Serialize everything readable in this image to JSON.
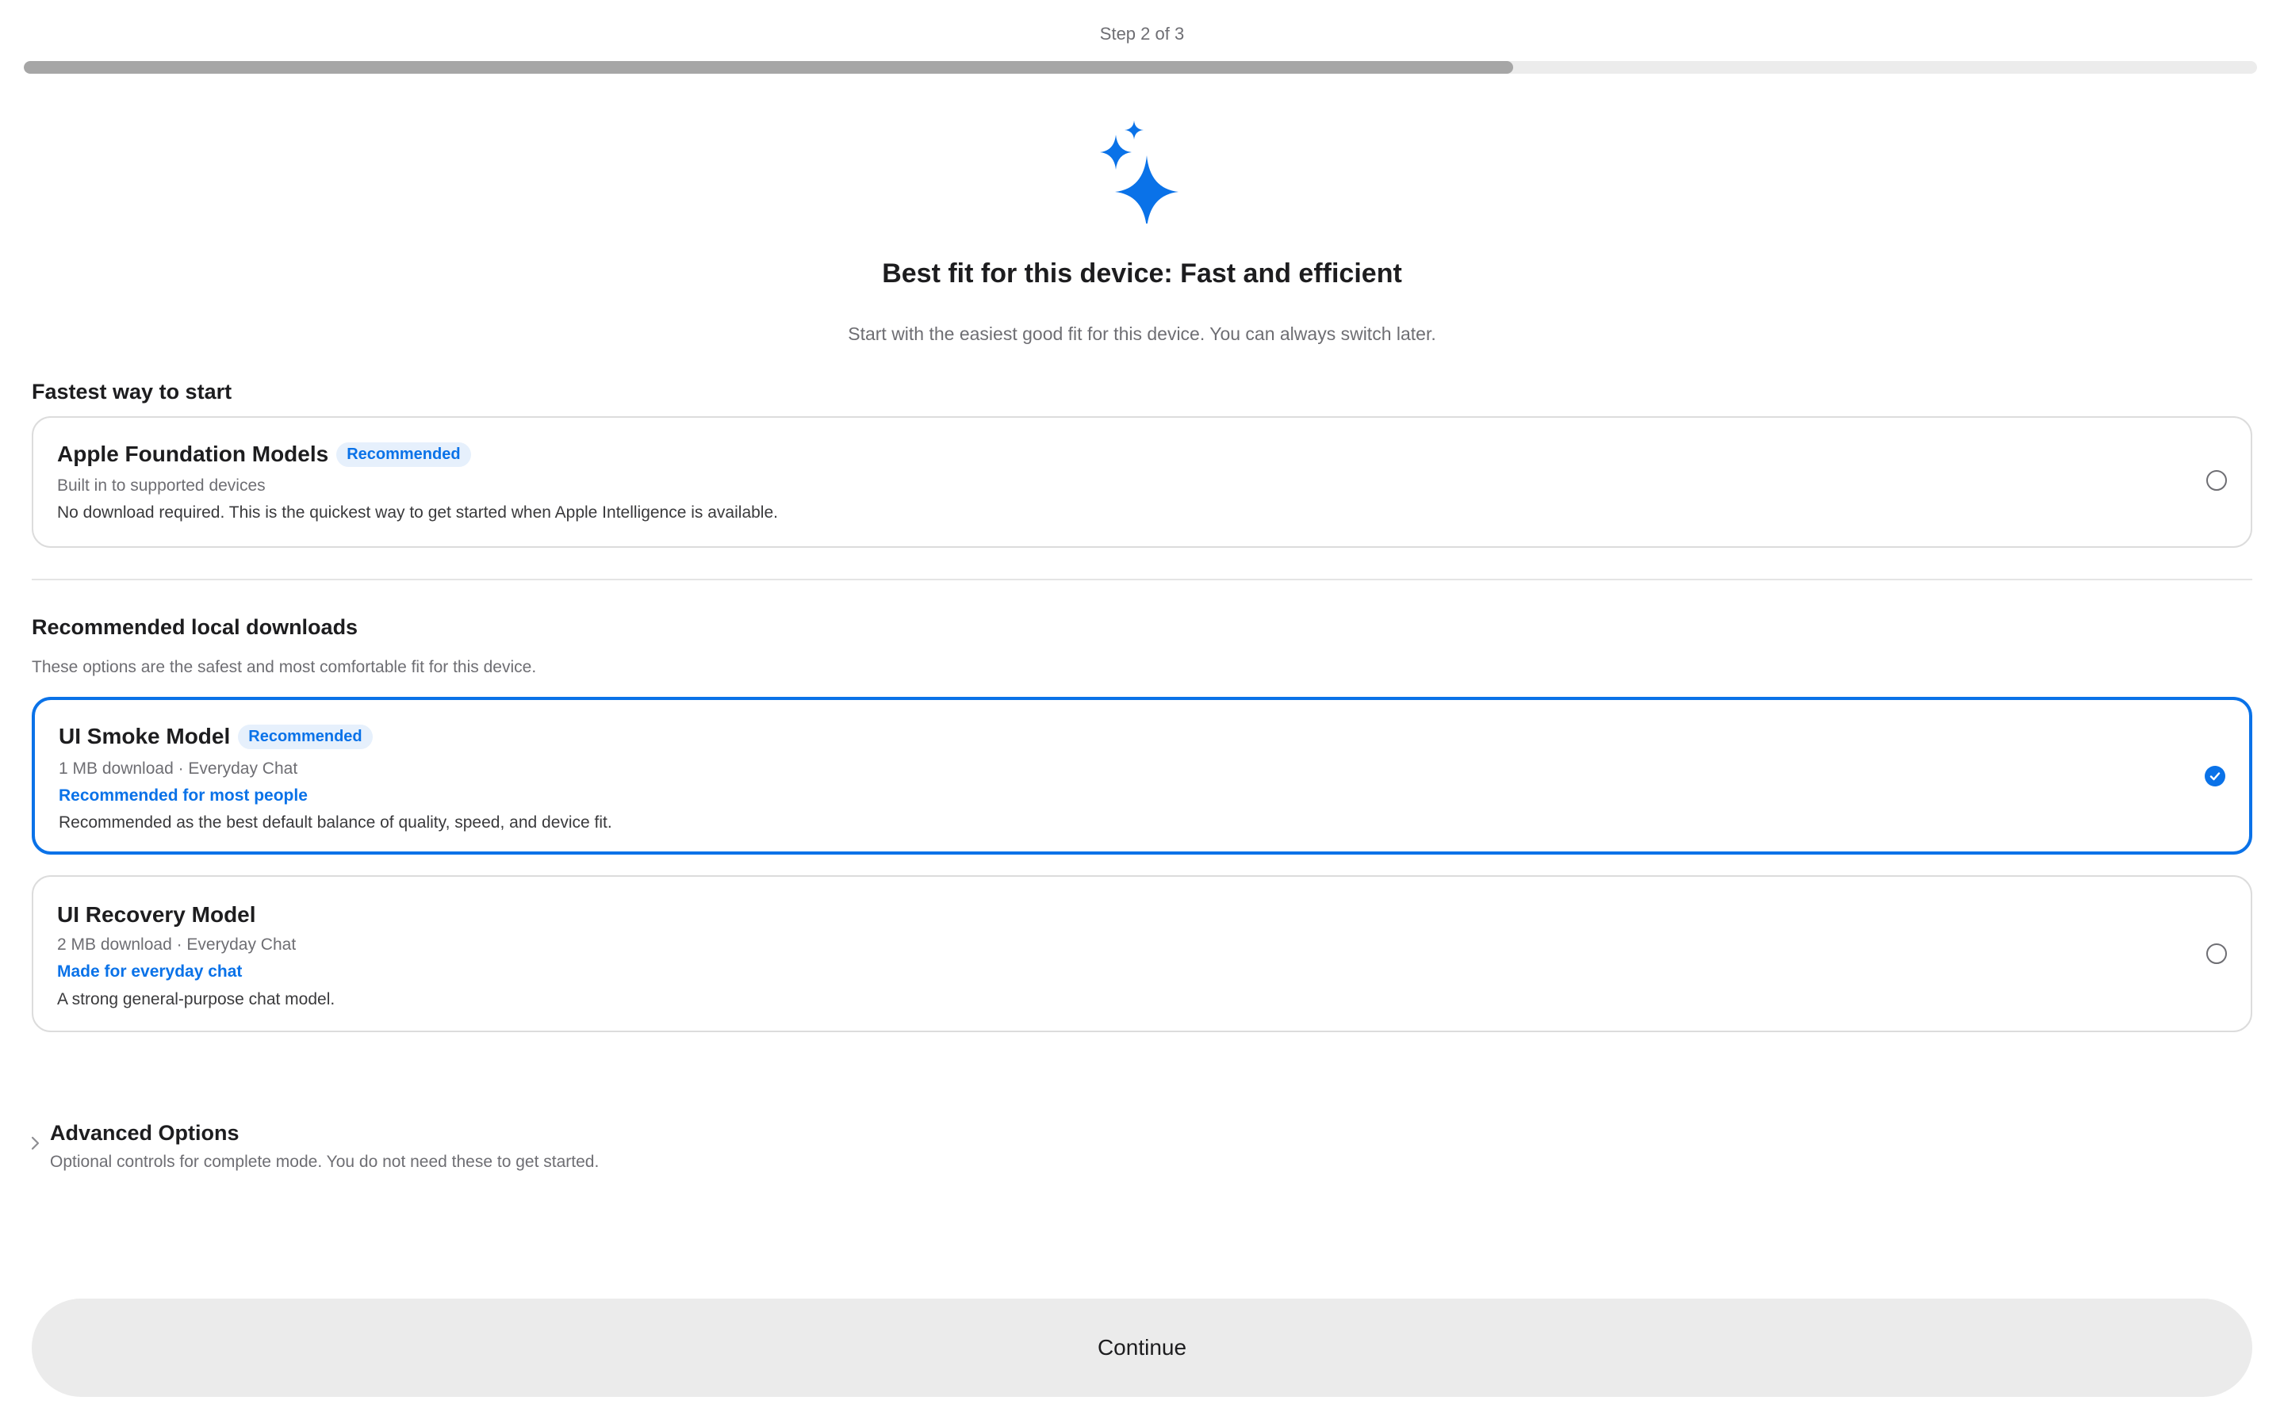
{
  "step_label": "Step 2 of 3",
  "progress": {
    "fraction": 0.667
  },
  "accent_color": "#0a72e8",
  "hero": {
    "icon": "sparkles-icon",
    "title": "Best fit for this device: Fast and efficient",
    "subtitle": "Start with the easiest good fit for this device. You can always switch later."
  },
  "fastest_section": {
    "title": "Fastest way to start",
    "card": {
      "title": "Apple Foundation Models",
      "badge": "Recommended",
      "meta": "Built in to supported devices",
      "description": "No download required. This is the quickest way to get started when Apple Intelligence is available.",
      "selected": false
    }
  },
  "downloads_section": {
    "title": "Recommended local downloads",
    "description": "These options are the safest and most comfortable fit for this device.",
    "cards": [
      {
        "title": "UI Smoke Model",
        "badge": "Recommended",
        "meta": "1 MB download · Everyday Chat",
        "highlight": "Recommended for most people",
        "description": "Recommended as the best default balance of quality, speed, and device fit.",
        "selected": true
      },
      {
        "title": "UI Recovery Model",
        "meta": "2 MB download · Everyday Chat",
        "highlight": "Made for everyday chat",
        "description": "A strong general-purpose chat model.",
        "selected": false
      }
    ]
  },
  "advanced": {
    "title": "Advanced Options",
    "description": "Optional controls for complete mode. You do not need these to get started.",
    "icon": "chevron-right-icon"
  },
  "continue_label": "Continue"
}
